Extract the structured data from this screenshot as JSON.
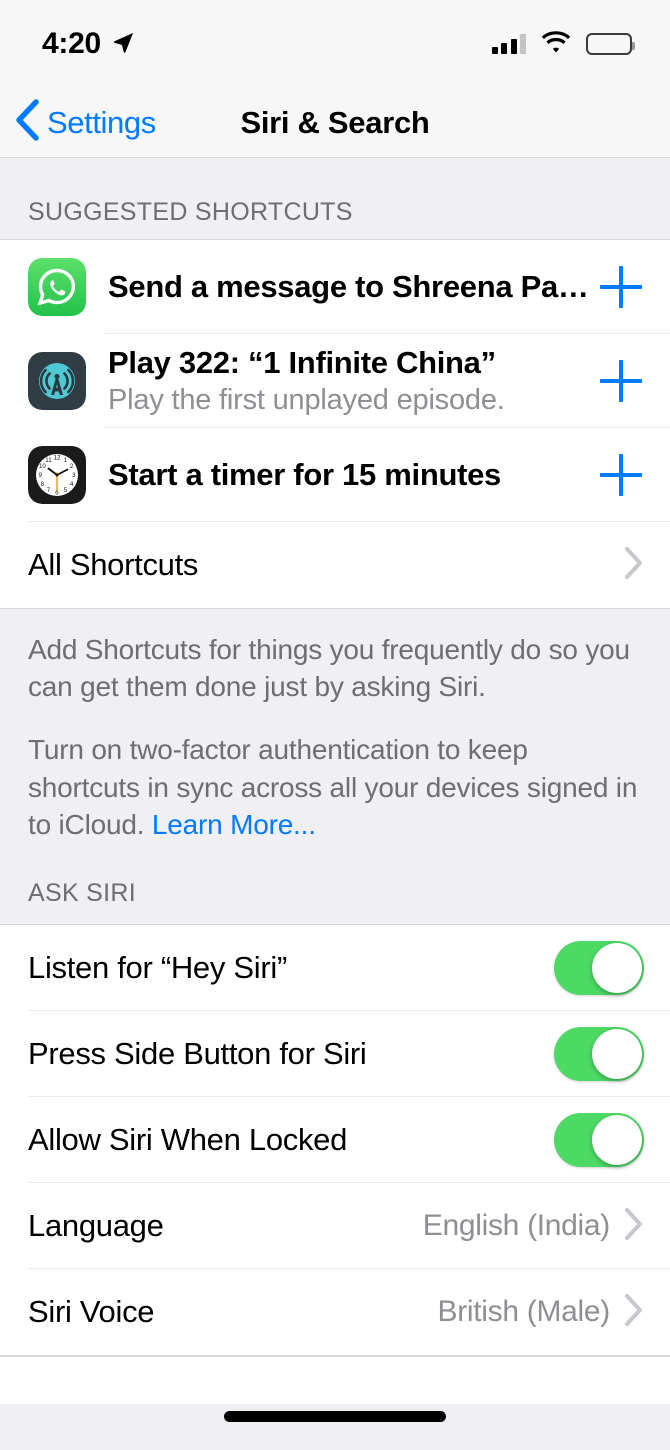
{
  "status_bar": {
    "time": "4:20",
    "location_icon": "location-arrow-icon",
    "cellular_icon": "cellular-bars-icon",
    "cellular_bars_filled": 3,
    "cellular_bars_total": 4,
    "wifi_icon": "wifi-icon",
    "battery_icon": "battery-icon"
  },
  "nav": {
    "back_label": "Settings",
    "back_icon": "chevron-left-icon",
    "title": "Siri & Search"
  },
  "sections": {
    "suggested": {
      "header": "SUGGESTED SHORTCUTS",
      "shortcuts": [
        {
          "app_icon": "whatsapp-icon",
          "title": "Send a message to Shreena Par…",
          "subtitle": "",
          "action_icon": "plus-icon"
        },
        {
          "app_icon": "overcast-podcast-icon",
          "title": "Play 322: “1 Infinite China”",
          "subtitle": "Play the first unplayed episode.",
          "action_icon": "plus-icon"
        },
        {
          "app_icon": "clock-icon",
          "title": "Start a timer for 15 minutes",
          "subtitle": "",
          "action_icon": "plus-icon"
        }
      ],
      "all_shortcuts": {
        "label": "All Shortcuts",
        "disclosure_icon": "chevron-right-icon"
      },
      "footer_paragraph_1": "Add Shortcuts for things you frequently do so you can get them done just by asking Siri.",
      "footer_paragraph_2_pre": "Turn on two-factor authentication to keep shortcuts in sync across all your devices signed in to iCloud. ",
      "footer_link": "Learn More..."
    },
    "ask_siri": {
      "header": "ASK SIRI",
      "toggles": [
        {
          "label": "Listen for “Hey Siri”",
          "value": "on"
        },
        {
          "label": "Press Side Button for Siri",
          "value": "on"
        },
        {
          "label": "Allow Siri When Locked",
          "value": "on"
        }
      ],
      "pickers": [
        {
          "label": "Language",
          "value": "English (India)",
          "disclosure_icon": "chevron-right-icon"
        },
        {
          "label": "Siri Voice",
          "value": "British (Male)",
          "disclosure_icon": "chevron-right-icon"
        }
      ]
    }
  },
  "colors": {
    "tint": "#007AFF",
    "toggle_on": "#4CD964",
    "group_background": "#EFEFF4",
    "secondary_text": "#8E8E93",
    "header_text": "#6D6D72"
  },
  "home_indicator": "home-indicator"
}
